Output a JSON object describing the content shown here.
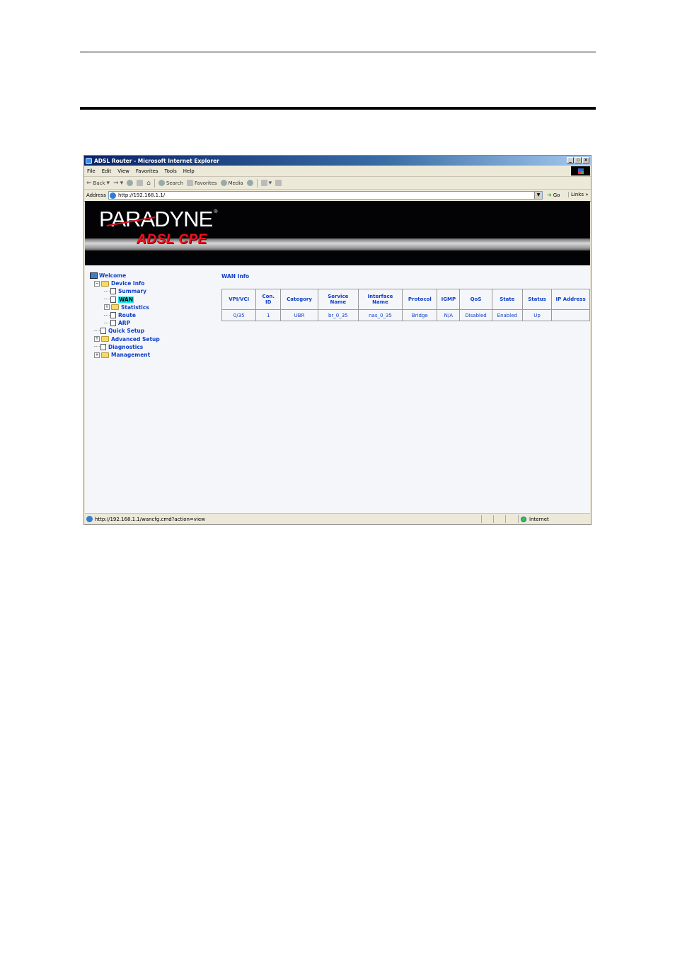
{
  "browser": {
    "title": "ADSL Router - Microsoft Internet Explorer",
    "window_buttons": [
      "_",
      "▫",
      "×"
    ],
    "menu": [
      "File",
      "Edit",
      "View",
      "Favorites",
      "Tools",
      "Help"
    ],
    "toolbar": {
      "back": "Back",
      "search": "Search",
      "favorites": "Favorites",
      "media": "Media"
    },
    "address_label": "Address",
    "address_value": "http://192.168.1.1/",
    "go_label": "Go",
    "links_label": "Links »"
  },
  "banner": {
    "brand": "PARADYNE",
    "registered": "®",
    "product": "ADSL CPE"
  },
  "nav": {
    "items": [
      {
        "label": "Welcome",
        "level": 0,
        "type": "computer"
      },
      {
        "label": "Device Info",
        "level": 1,
        "type": "folder",
        "expand": "−"
      },
      {
        "label": "Summary",
        "level": 2,
        "type": "page"
      },
      {
        "label": "WAN",
        "level": 2,
        "type": "page",
        "selected": true
      },
      {
        "label": "Statistics",
        "level": 2,
        "type": "folder",
        "expand": "+"
      },
      {
        "label": "Route",
        "level": 2,
        "type": "page"
      },
      {
        "label": "ARP",
        "level": 2,
        "type": "page"
      },
      {
        "label": "Quick Setup",
        "level": 1,
        "type": "page"
      },
      {
        "label": "Advanced Setup",
        "level": 1,
        "type": "folder",
        "expand": "+"
      },
      {
        "label": "Diagnostics",
        "level": 1,
        "type": "page"
      },
      {
        "label": "Management",
        "level": 1,
        "type": "folder",
        "expand": "+"
      }
    ]
  },
  "content": {
    "title": "WAN Info",
    "table": {
      "headers": [
        "VPI/VCI",
        "Con. ID",
        "Category",
        "Service Name",
        "Interface Name",
        "Protocol",
        "IGMP",
        "QoS",
        "State",
        "Status",
        "IP Address"
      ],
      "rows": [
        [
          "0/35",
          "1",
          "UBR",
          "br_0_35",
          "nas_0_35",
          "Bridge",
          "N/A",
          "Disabled",
          "Enabled",
          "Up",
          ""
        ]
      ]
    }
  },
  "statusbar": {
    "url": "http://192.168.1.1/wancfg.cmd?action=view",
    "zone": "Internet"
  }
}
